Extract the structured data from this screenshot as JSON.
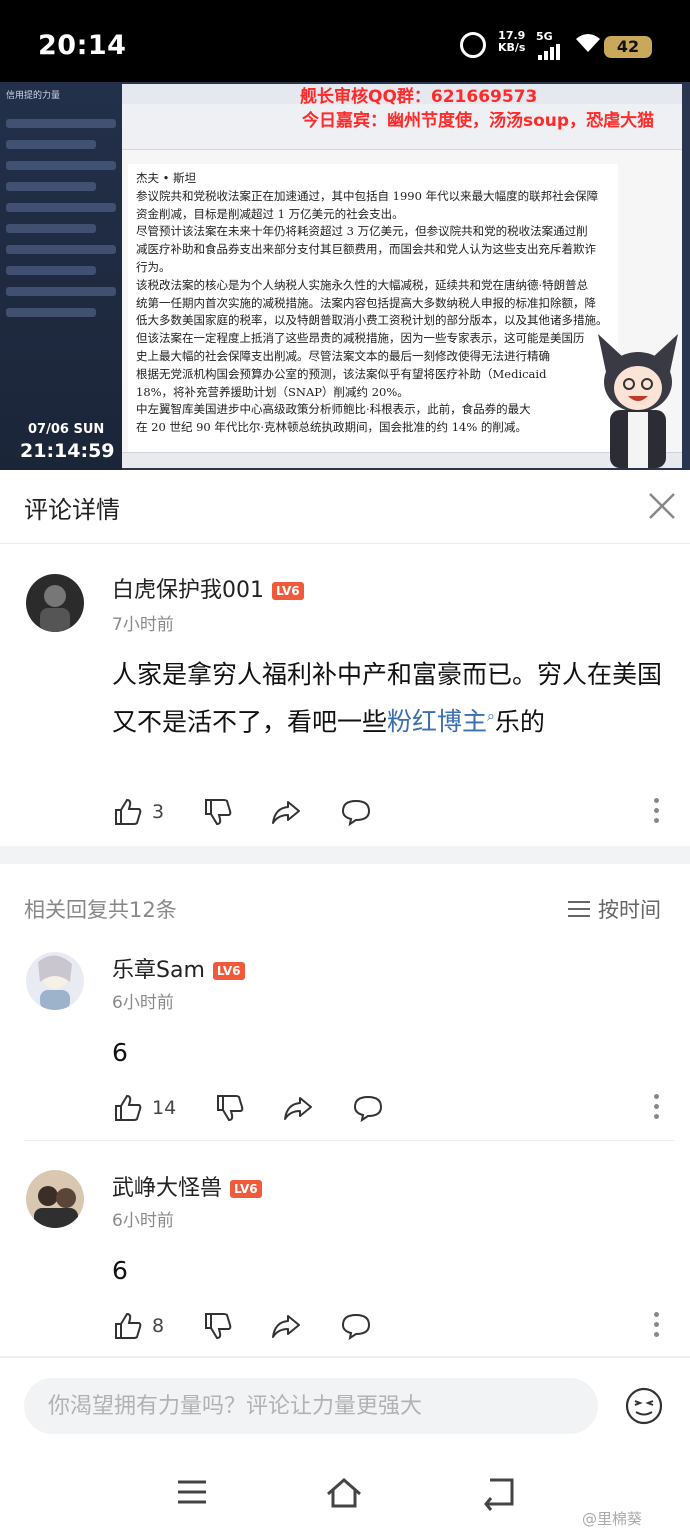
{
  "status_bar": {
    "time": "20:14",
    "net_speed": "17.9",
    "net_unit": "KB/s",
    "net_type": "5G",
    "battery": "42"
  },
  "stream": {
    "chat_title": "信用提的力量",
    "date": "07/06 SUN",
    "clock": "21:14:59",
    "overlay_line1": "舰长审核QQ群：621669573",
    "overlay_line2": "今日嘉宾：幽州节度使，汤汤soup，恐虐大猫",
    "doc_lines": [
      "杰夫   • 斯坦",
      "参议院共和党税收法案正在加速通过，其中包括自 1990 年代以来最大幅度的联邦社会保障",
      "资金削减，目标是削减超过 1 万亿美元的社会支出。",
      "尽管预计该法案在未来十年仍将耗资超过 3 万亿美元，但参议院共和党的税收法案通过削",
      "减医疗补助和食品券支出来部分支付其巨额费用，而国会共和党人认为这些支出充斥着欺诈",
      "行为。",
      "该税改法案的核心是为个人纳税人实施永久性的大幅减税，延续共和党在唐纳德·特朗普总",
      "统第一任期内首次实施的减税措施。法案内容包括提高大多数纳税人申报的标准扣除额，降",
      "低大多数美国家庭的税率，以及特朗普取消小费工资税计划的部分版本，以及其他诸多措施。",
      "但该法案在一定程度上抵消了这些昂贵的减税措施，因为一些专家表示，这可能是美国历",
      "史上最大幅的社会保障支出削减。尽管法案文本的最后一刻修改使得无法进行精确",
      "根据无党派机构国会预算办公室的预测，该法案似乎有望将医疗补助（Medicaid",
      "18%，将补充营养援助计划（SNAP）削减约 20%。",
      "中左翼智库美国进步中心高级政策分析师鲍比·科根表示，此前，食品券的最大",
      "在 20 世纪 90 年代比尔·克林顿总统执政期间，国会批准的约 14% 的削减。"
    ]
  },
  "panel": {
    "title": "评论详情"
  },
  "main_comment": {
    "username": "白虎保护我001",
    "level": "LV6",
    "time": "7小时前",
    "text_before_link": "人家是拿穷人福利补中产和富豪而已。穷人在美国又不是活不了，看吧一些",
    "link_text": "粉红博主",
    "text_after_link": "乐的",
    "likes": "3"
  },
  "replies_header": {
    "count_label": "相关回复共12条",
    "sort_label": "按时间"
  },
  "replies": [
    {
      "username": "乐章Sam",
      "level": "LV6",
      "time": "6小时前",
      "text": "6",
      "likes": "14"
    },
    {
      "username": "武峥大怪兽",
      "level": "LV6",
      "time": "6小时前",
      "text": "6",
      "likes": "8"
    }
  ],
  "composer": {
    "placeholder": "你渴望拥有力量吗？评论让力量更强大"
  },
  "watermark": "@里棉葵"
}
